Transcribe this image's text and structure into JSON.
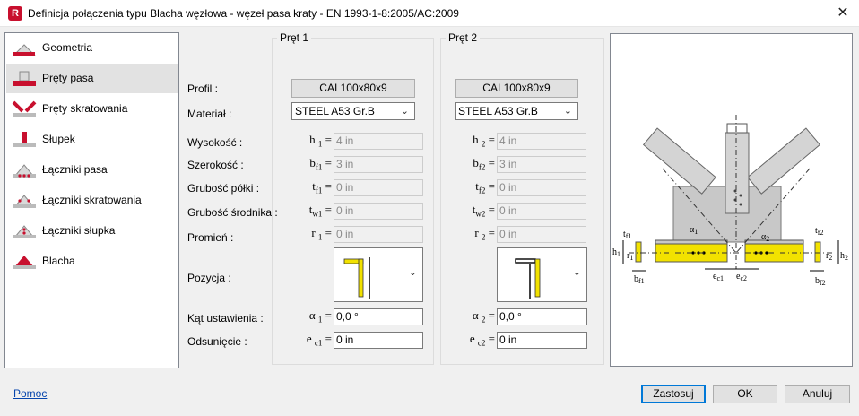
{
  "window": {
    "title": "Definicja połączenia typu Blacha węzłowa - węzeł pasa kraty - EN 1993-1-8:2005/AC:2009",
    "app_icon_letter": "R"
  },
  "nav": [
    {
      "label": "Geometria",
      "icon": "geometry-icon"
    },
    {
      "label": "Pręty pasa",
      "icon": "chord-bars-icon"
    },
    {
      "label": "Pręty skratowania",
      "icon": "diagonal-bars-icon"
    },
    {
      "label": "Słupek",
      "icon": "post-icon"
    },
    {
      "label": "Łączniki pasa",
      "icon": "chord-connectors-icon"
    },
    {
      "label": "Łączniki skratowania",
      "icon": "diagonal-connectors-icon"
    },
    {
      "label": "Łączniki słupka",
      "icon": "post-connectors-icon"
    },
    {
      "label": "Blacha",
      "icon": "plate-icon"
    }
  ],
  "selected_nav": "Pręty pasa",
  "labels": {
    "profil": "Profil :",
    "material": "Materiał :",
    "wysokosc": "Wysokość :",
    "szerokosc": "Szerokość :",
    "grubosc_polki": "Grubość półki :",
    "grubosc_srodnika": "Grubość środnika :",
    "promien": "Promień :",
    "pozycja": "Pozycja :",
    "kat": "Kąt ustawienia :",
    "odsuniecie": "Odsunięcie :"
  },
  "bar1": {
    "title": "Pręt 1",
    "profile": "CAI 100x80x9",
    "material": "STEEL A53 Gr.B",
    "h": {
      "sym": "h",
      "sub": "1",
      "value": "4 in"
    },
    "b": {
      "sym": "b",
      "sub": "f1",
      "value": "3 in"
    },
    "tf": {
      "sym": "t",
      "sub": "f1",
      "value": "0 in"
    },
    "tw": {
      "sym": "t",
      "sub": "w1",
      "value": "0 in"
    },
    "r": {
      "sym": "r",
      "sub": "1",
      "value": "0 in"
    },
    "alpha": {
      "sym": "α",
      "sub": "1",
      "value": "0,0 °"
    },
    "ec": {
      "sym": "e",
      "sub": "c1",
      "value": "0 in"
    }
  },
  "bar2": {
    "title": "Pręt 2",
    "profile": "CAI 100x80x9",
    "material": "STEEL A53 Gr.B",
    "h": {
      "sym": "h",
      "sub": "2",
      "value": "4 in"
    },
    "b": {
      "sym": "b",
      "sub": "f2",
      "value": "3 in"
    },
    "tf": {
      "sym": "t",
      "sub": "f2",
      "value": "0 in"
    },
    "tw": {
      "sym": "t",
      "sub": "w2",
      "value": "0 in"
    },
    "r": {
      "sym": "r",
      "sub": "2",
      "value": "0 in"
    },
    "alpha": {
      "sym": "α",
      "sub": "2",
      "value": "0,0 °"
    },
    "ec": {
      "sym": "e",
      "sub": "c2",
      "value": "0 in"
    }
  },
  "equals": "=",
  "preview_labels": {
    "tf1": "t",
    "tf1_sub": "f1",
    "tf2": "t",
    "tf2_sub": "f2",
    "h1": "h",
    "h1_sub": "1",
    "h2": "h",
    "h2_sub": "2",
    "r1": "r",
    "r1_sub": "1",
    "r2": "r",
    "r2_sub": "2",
    "a1": "α",
    "a1_sub": "1",
    "a2": "α",
    "a2_sub": "2",
    "ec1": "e",
    "ec1_sub": "c1",
    "ec2": "e",
    "ec2_sub": "c2",
    "bf1": "b",
    "bf1_sub": "f1",
    "bf2": "b",
    "bf2_sub": "f2"
  },
  "footer": {
    "help": "Pomoc",
    "apply": "Zastosuj",
    "ok": "OK",
    "cancel": "Anuluj"
  },
  "colors": {
    "accent_red": "#c8102e",
    "selection": "#e2e2e2",
    "beam_yellow": "#f2e200",
    "link_blue": "#0645ad"
  }
}
